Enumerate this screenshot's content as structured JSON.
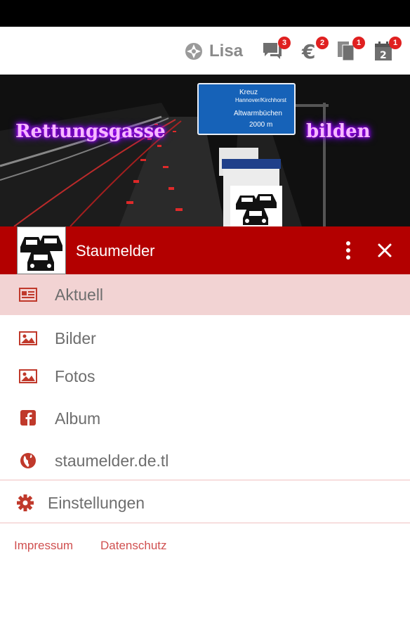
{
  "topbar": {
    "user_name": "Lisa",
    "badges": {
      "messages": "3",
      "euro": "2",
      "pages": "1",
      "calendar": "1"
    }
  },
  "banner": {
    "text_left": "Rettungsgasse",
    "text_right": "bilden",
    "sign": {
      "line1": "Kreuz",
      "line2": "Hannover/Kirchhorst",
      "line3": "Altwarmbüchen",
      "line4": "2000 m"
    }
  },
  "app": {
    "title": "Staumelder"
  },
  "menu": {
    "items": [
      {
        "label": "Aktuell",
        "icon": "newspaper-icon"
      },
      {
        "label": "Bilder",
        "icon": "image-icon"
      },
      {
        "label": "Fotos",
        "icon": "image-icon"
      },
      {
        "label": "Album",
        "icon": "facebook-icon"
      },
      {
        "label": "staumelder.de.tl",
        "icon": "globe-icon"
      }
    ],
    "settings": {
      "label": "Einstellungen",
      "icon": "gear-icon"
    }
  },
  "footer": {
    "impressum": "Impressum",
    "datenschutz": "Datenschutz"
  },
  "colors": {
    "primary": "#b30000",
    "active_bg": "#f2d3d3",
    "icon": "#c0392b",
    "badge": "#e02020"
  }
}
